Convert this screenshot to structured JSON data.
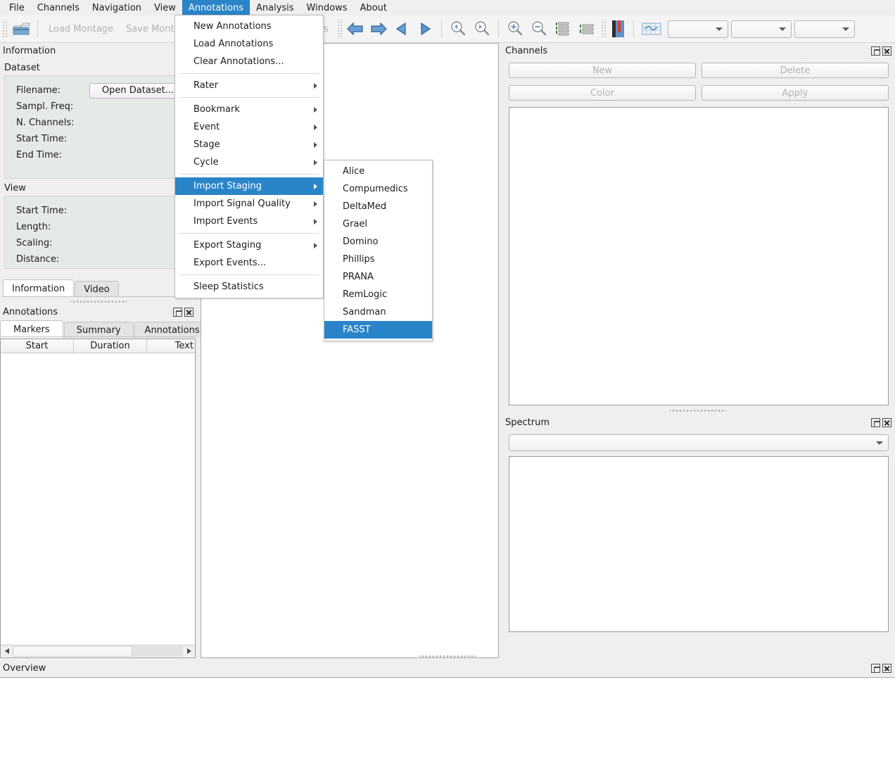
{
  "app": {
    "menubar": [
      {
        "label": "File",
        "active": false
      },
      {
        "label": "Channels",
        "active": false
      },
      {
        "label": "Navigation",
        "active": false
      },
      {
        "label": "View",
        "active": false
      },
      {
        "label": "Annotations",
        "active": true
      },
      {
        "label": "Analysis",
        "active": false
      },
      {
        "label": "Windows",
        "active": false
      },
      {
        "label": "About",
        "active": false
      }
    ]
  },
  "toolbar": {
    "open_dataset_icon": "open-folder-icon",
    "load_montage_label": "Load Montage",
    "save_montage_label": "Save Montage",
    "annotations_label": "Annotations",
    "nav_icons": [
      "arrow-left-big-icon",
      "arrow-right-big-icon",
      "step-back-icon",
      "step-forward-icon"
    ],
    "zoom_icons": [
      "zoom-page-left-icon",
      "zoom-page-right-icon",
      "zoom-in-icon",
      "zoom-out-icon",
      "lines-more-icon",
      "lines-less-icon"
    ],
    "signal_icon": "signal-thumb-icon",
    "grid_icon": "grid-icon",
    "combos": [
      {
        "name": "combo-1",
        "value": ""
      },
      {
        "name": "combo-2",
        "value": ""
      },
      {
        "name": "combo-3",
        "value": ""
      }
    ]
  },
  "annotations_menu": {
    "items": [
      {
        "label": "New Annotations",
        "submenu": false,
        "highlight": false,
        "sep_after": false
      },
      {
        "label": "Load Annotations",
        "submenu": false,
        "highlight": false,
        "sep_after": false
      },
      {
        "label": "Clear Annotations...",
        "submenu": false,
        "highlight": false,
        "sep_after": true
      },
      {
        "label": "Rater",
        "submenu": true,
        "highlight": false,
        "sep_after": true
      },
      {
        "label": "Bookmark",
        "submenu": true,
        "highlight": false,
        "sep_after": false
      },
      {
        "label": "Event",
        "submenu": true,
        "highlight": false,
        "sep_after": false
      },
      {
        "label": "Stage",
        "submenu": true,
        "highlight": false,
        "sep_after": false
      },
      {
        "label": "Cycle",
        "submenu": true,
        "highlight": false,
        "sep_after": true
      },
      {
        "label": "Import Staging",
        "submenu": true,
        "highlight": true,
        "sep_after": false
      },
      {
        "label": "Import Signal Quality",
        "submenu": true,
        "highlight": false,
        "sep_after": false
      },
      {
        "label": "Import Events",
        "submenu": true,
        "highlight": false,
        "sep_after": true
      },
      {
        "label": "Export Staging",
        "submenu": true,
        "highlight": false,
        "sep_after": false
      },
      {
        "label": "Export Events...",
        "submenu": false,
        "highlight": false,
        "sep_after": true
      },
      {
        "label": "Sleep Statistics",
        "submenu": false,
        "highlight": false,
        "sep_after": false
      }
    ]
  },
  "import_staging_submenu": {
    "items": [
      {
        "label": "Alice",
        "highlight": false
      },
      {
        "label": "Compumedics",
        "highlight": false
      },
      {
        "label": "DeltaMed",
        "highlight": false
      },
      {
        "label": "Grael",
        "highlight": false
      },
      {
        "label": "Domino",
        "highlight": false
      },
      {
        "label": "Phillips",
        "highlight": false
      },
      {
        "label": "PRANA",
        "highlight": false
      },
      {
        "label": "RemLogic",
        "highlight": false
      },
      {
        "label": "Sandman",
        "highlight": false
      },
      {
        "label": "FASST",
        "highlight": true
      }
    ]
  },
  "information_panel": {
    "title": "Information",
    "dataset_group": "Dataset",
    "dataset_fields": [
      {
        "label": "Filename:",
        "value": ""
      },
      {
        "label": "Sampl. Freq:",
        "value": ""
      },
      {
        "label": "N. Channels:",
        "value": ""
      },
      {
        "label": "Start Time:",
        "value": ""
      },
      {
        "label": "End Time:",
        "value": ""
      }
    ],
    "open_dataset_button": "Open Dataset...",
    "view_group": "View",
    "view_fields": [
      {
        "label": "Start Time:",
        "value": ""
      },
      {
        "label": "Length:",
        "value": ""
      },
      {
        "label": "Scaling:",
        "value": ""
      },
      {
        "label": "Distance:",
        "value": ""
      }
    ],
    "tabs": [
      {
        "label": "Information",
        "selected": true
      },
      {
        "label": "Video",
        "selected": false
      }
    ]
  },
  "annotations_panel": {
    "title": "Annotations",
    "tabs": [
      {
        "label": "Markers",
        "selected": true
      },
      {
        "label": "Summary",
        "selected": false
      },
      {
        "label": "Annotations",
        "selected": false
      }
    ],
    "columns": [
      "Start",
      "Duration",
      "Text"
    ],
    "rows": []
  },
  "channels_panel": {
    "title": "Channels",
    "buttons": [
      {
        "label": "New",
        "enabled": false
      },
      {
        "label": "Delete",
        "enabled": false
      },
      {
        "label": "Color",
        "enabled": false
      },
      {
        "label": "Apply",
        "enabled": false
      }
    ],
    "list_items": []
  },
  "spectrum_panel": {
    "title": "Spectrum",
    "combo_value": "",
    "plot_content": ""
  },
  "overview_panel": {
    "title": "Overview",
    "content": ""
  },
  "colors": {
    "accent": "#2a84c8",
    "window_bg": "#efeff0",
    "toolbar_bg": "#f4f4f5",
    "group_bg": "#e6eae6",
    "disabled_text": "#b4b4b4",
    "panel_border": "#a9a9a9"
  }
}
